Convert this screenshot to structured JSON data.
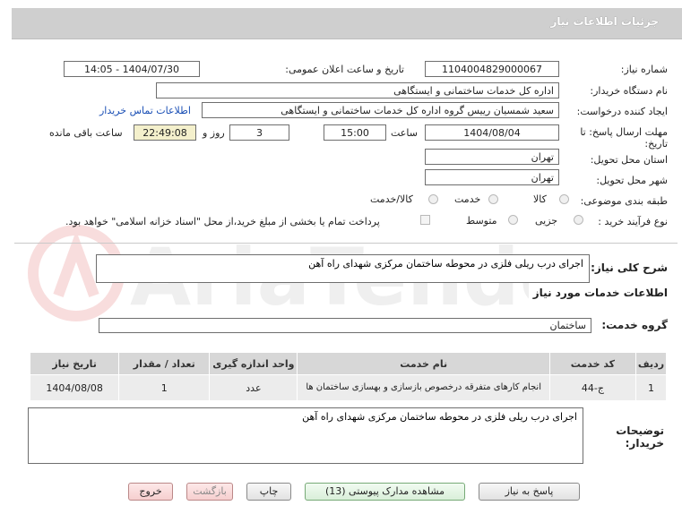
{
  "header": {
    "title": "جزئیات اطلاعات نیاز"
  },
  "form": {
    "need_number_label": "شماره نیاز:",
    "need_number": "1104004829000067",
    "announce_label": "تاریخ و ساعت اعلان عمومی:",
    "announce_value": "1404/07/30 - 14:05",
    "buyer_org_label": "نام دستگاه خریدار:",
    "buyer_org": "اداره کل خدمات ساختمانی و ایستگاهی",
    "requester_label": "ایجاد کننده درخواست:",
    "requester": "سعید شمسیان رییس گروه اداره کل خدمات ساختمانی و ایستگاهی",
    "contact_link": "اطلاعات تماس خریدار",
    "deadline_label_1": "مهلت ارسال پاسخ: تا",
    "deadline_label_2": "تاریخ:",
    "deadline_date": "1404/08/04",
    "time_label": "ساعت",
    "deadline_time": "15:00",
    "days_value": "3",
    "days_label": "روز و",
    "remaining_time": "22:49:08",
    "remaining_label": "ساعت باقی مانده",
    "province_label": "استان محل تحویل:",
    "province": "تهران",
    "city_label": "شهر محل تحویل:",
    "city": "تهران",
    "category_label": "طبقه بندی موضوعی:",
    "category_options": [
      "کالا",
      "خدمت",
      "کالا/خدمت"
    ],
    "purchase_type_label": "نوع فرآیند خرید :",
    "purchase_type_options": [
      "جزیی",
      "متوسط"
    ],
    "payment_note": "پرداخت تمام یا بخشی از مبلغ خرید،از محل \"اسناد خزانه اسلامی\" خواهد بود."
  },
  "summary": {
    "label": "شرح کلی نیاز:",
    "value": "اجرای درب ریلی فلزی در محوطه ساختمان مرکزی شهدای راه آهن"
  },
  "services": {
    "section_title": "اطلاعات خدمات مورد نیاز",
    "group_label": "گروه خدمت:",
    "group_value": "ساختمان",
    "columns": [
      "ردیف",
      "کد خدمت",
      "نام خدمت",
      "واحد اندازه گیری",
      "تعداد / مقدار",
      "تاریخ نیاز"
    ],
    "rows": [
      {
        "row": "1",
        "code": "ج-44",
        "name": "انجام کارهای متفرقه درخصوص بازسازی و بهسازی ساختمان ها",
        "unit": "عدد",
        "qty": "1",
        "date": "1404/08/08"
      }
    ]
  },
  "buyer_notes": {
    "label_1": "توضیحات",
    "label_2": "خریدار:",
    "value": "اجرای درب ریلی فلزی در محوطه ساختمان مرکزی شهدای راه آهن"
  },
  "buttons": {
    "reply": "پاسخ به نیاز",
    "attachments": "مشاهده مدارک پیوستی (13)",
    "print": "چاپ",
    "back": "بازگشت",
    "exit": "خروج"
  },
  "watermark_text": "AriaTender.net"
}
